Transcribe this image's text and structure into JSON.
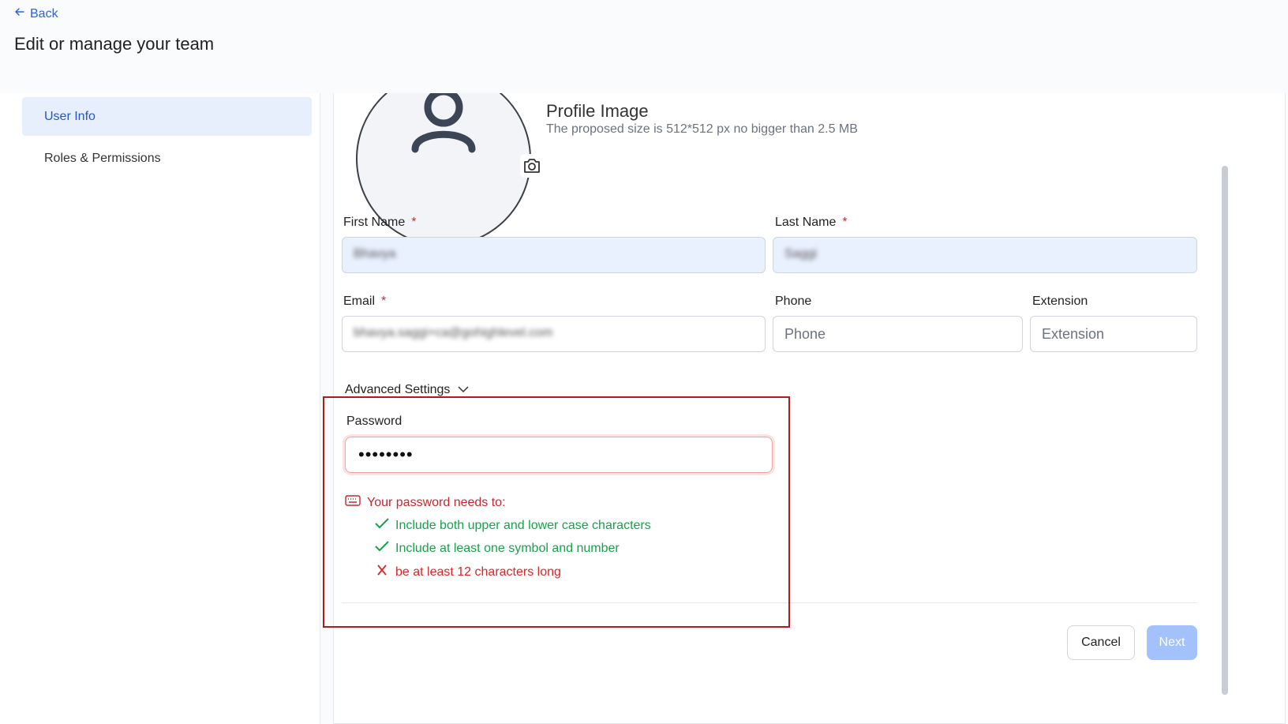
{
  "nav": {
    "back_label": "Back"
  },
  "page": {
    "title": "Edit or manage your team"
  },
  "sidebar": {
    "items": [
      {
        "label": "User Info"
      },
      {
        "label": "Roles & Permissions"
      }
    ]
  },
  "profile": {
    "title": "Profile Image",
    "subtitle": "The proposed size is 512*512 px no bigger than 2.5 MB"
  },
  "form": {
    "first_name": {
      "label": "First Name",
      "required_mark": "*",
      "value": "Bhavya"
    },
    "last_name": {
      "label": "Last Name",
      "required_mark": "*",
      "value": "Saggi"
    },
    "email": {
      "label": "Email",
      "required_mark": "*",
      "value": "bhavya.saggi+ca@gohighlevel.com"
    },
    "phone": {
      "label": "Phone",
      "placeholder": "Phone"
    },
    "extension": {
      "label": "Extension",
      "placeholder": "Extension"
    }
  },
  "advanced": {
    "label": "Advanced Settings",
    "password": {
      "label": "Password",
      "value": "••••••••",
      "requirements_title": "Your password needs to:",
      "requirements": [
        {
          "text": "Include both upper and lower case characters",
          "status": "met"
        },
        {
          "text": "Include at least one symbol and number",
          "status": "met"
        },
        {
          "text": "be at least 12 characters long",
          "status": "unmet"
        }
      ]
    }
  },
  "actions": {
    "cancel_label": "Cancel",
    "next_label": "Next"
  },
  "colors": {
    "accent": "#2563eb",
    "success": "#16a34a",
    "error": "#dc2626",
    "highlight_border": "#b01c1c"
  }
}
